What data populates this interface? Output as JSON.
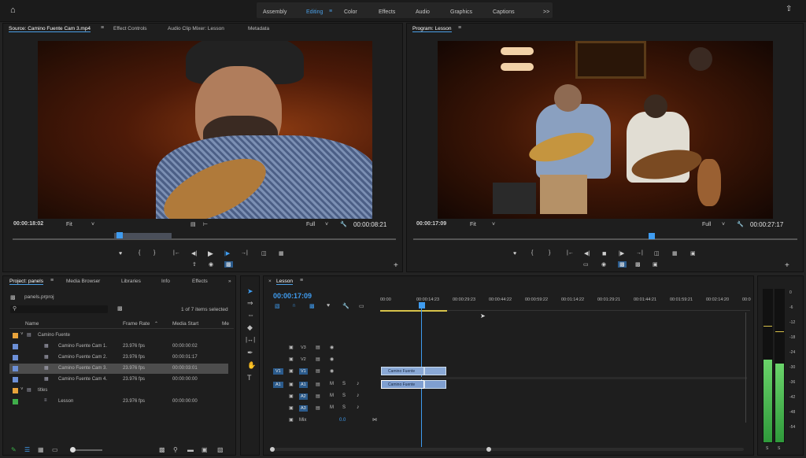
{
  "workspaces": [
    "Assembly",
    "Editing",
    "Color",
    "Effects",
    "Audio",
    "Graphics",
    "Captions"
  ],
  "more_workspaces": ">>",
  "source": {
    "tabs": [
      "Source: Camino Fuente Cam 3.mp4",
      "Effect Controls",
      "Audio Clip Mixer: Lesson",
      "Metadata"
    ],
    "timecode": "00:00:18:02",
    "fit": "Fit",
    "quality": "Full",
    "duration": "00:00:08:21"
  },
  "program": {
    "tab": "Program: Lesson",
    "timecode": "00:00:17:09",
    "fit": "Fit",
    "quality": "Full",
    "duration": "00:00:27:17"
  },
  "project": {
    "tabs": [
      "Project: panels",
      "Media Browser",
      "Libraries",
      "Info",
      "Effects"
    ],
    "file": "panels.prproj",
    "count": "1 of 7 items selected",
    "columns": [
      "Name",
      "Frame Rate",
      "Media Start",
      "Me"
    ],
    "items": [
      {
        "name": "Camino Fuente",
        "rate": "",
        "start": "",
        "color": "#e8a33b",
        "indent": 0,
        "type": "folder"
      },
      {
        "name": "Camino Fuente Cam 1.",
        "rate": "23.976 fps",
        "start": "00:00:00:02",
        "color": "#6c8fd6",
        "indent": 1,
        "type": "clip"
      },
      {
        "name": "Camino Fuente Cam 2.",
        "rate": "23.976 fps",
        "start": "00:00:01:17",
        "color": "#6c8fd6",
        "indent": 1,
        "type": "clip"
      },
      {
        "name": "Camino Fuente Cam 3.",
        "rate": "23.976 fps",
        "start": "00:00:03:01",
        "color": "#6c8fd6",
        "indent": 1,
        "type": "clip",
        "selected": true
      },
      {
        "name": "Camino Fuente Cam 4.",
        "rate": "23.976 fps",
        "start": "00:00:00:00",
        "color": "#6c8fd6",
        "indent": 1,
        "type": "clip"
      },
      {
        "name": "titles",
        "rate": "",
        "start": "",
        "color": "#e8a33b",
        "indent": 0,
        "type": "folder"
      },
      {
        "name": "Lesson",
        "rate": "23.976 fps",
        "start": "00:00:00:00",
        "color": "#3fae4a",
        "indent": 1,
        "type": "sequence"
      }
    ]
  },
  "timeline": {
    "tab": "Lesson",
    "timecode": "00:00:17:09",
    "ruler": [
      "00:00",
      "00:00:14:23",
      "00:00:29:23",
      "00:00:44:22",
      "00:00:59:22",
      "00:01:14:22",
      "00:01:29:21",
      "00:01:44:21",
      "00:01:59:21",
      "00:02:14:20",
      "00:0"
    ],
    "video_tracks": [
      "V3",
      "V2",
      "V1"
    ],
    "audio_tracks": [
      "A1",
      "A2",
      "A3"
    ],
    "mix_label": "Mix",
    "mix_value": "0.0",
    "clip_label": "Camino Fuente"
  },
  "meter": {
    "scale": [
      "0",
      "-6",
      "-12",
      "-18",
      "-24",
      "-30",
      "-36",
      "-42",
      "-48",
      "-54"
    ],
    "bottom": [
      "S",
      "S"
    ]
  },
  "colors": {
    "accent": "#3f9cf0",
    "clip": "#8aa9d6",
    "meter": "#3cb34a"
  }
}
